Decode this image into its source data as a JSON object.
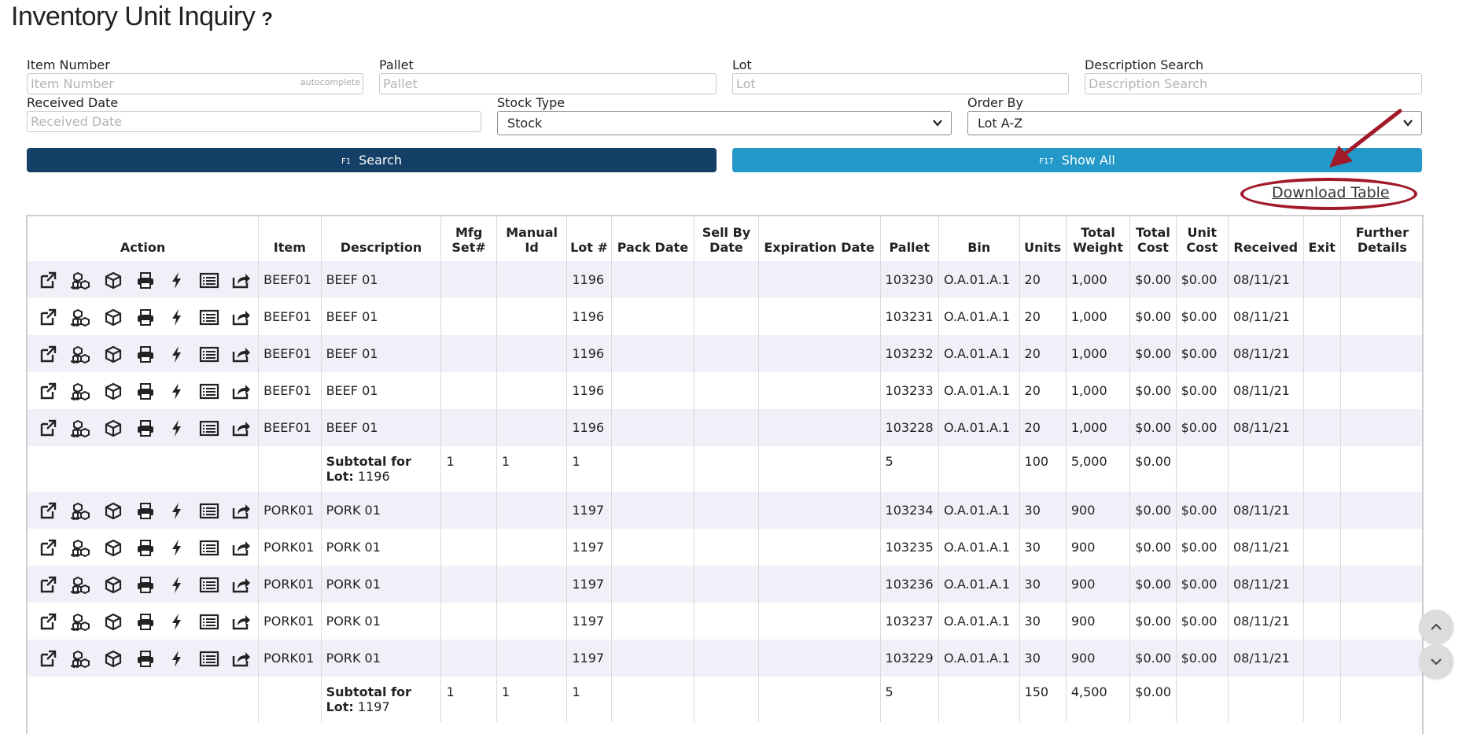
{
  "page": {
    "title": "Inventory Unit Inquiry",
    "help_label": "?"
  },
  "filters": {
    "item_number": {
      "label": "Item Number",
      "placeholder": "Item Number",
      "hint": "autocomplete"
    },
    "pallet": {
      "label": "Pallet",
      "placeholder": "Pallet"
    },
    "lot": {
      "label": "Lot",
      "placeholder": "Lot"
    },
    "description": {
      "label": "Description Search",
      "placeholder": "Description Search"
    },
    "received_date": {
      "label": "Received Date",
      "placeholder": "Received Date"
    },
    "stock_type": {
      "label": "Stock Type",
      "value": "Stock"
    },
    "order_by": {
      "label": "Order By",
      "value": "Lot A-Z"
    }
  },
  "buttons": {
    "search": {
      "key": "F1",
      "label": "Search"
    },
    "show_all": {
      "key": "F17",
      "label": "Show All"
    },
    "download": "Download Table"
  },
  "colors": {
    "search_button": "#143f66",
    "show_all_button": "#2399c9",
    "annotation": "#a11a2a",
    "row_stripe": "#eff0f8"
  },
  "action_icons": [
    "external-link-icon",
    "boxes-icon",
    "box-icon",
    "print-icon",
    "bolt-icon",
    "list-icon",
    "share-icon"
  ],
  "table": {
    "headers": [
      "Action",
      "Item",
      "Description",
      "Mfg Set#",
      "Manual Id",
      "Lot #",
      "Pack Date",
      "Sell By Date",
      "Expiration Date",
      "Pallet",
      "Bin",
      "Units",
      "Total Weight",
      "Total Cost",
      "Unit Cost",
      "Received",
      "Exit",
      "Further Details"
    ],
    "rows": [
      {
        "item": "BEEF01",
        "description": "BEEF 01",
        "lot": "1196",
        "pallet": "103230",
        "bin": "O.A.01.A.1",
        "units": "20",
        "weight": "1,000",
        "total_cost": "$0.00",
        "unit_cost": "$0.00",
        "received": "08/11/21"
      },
      {
        "item": "BEEF01",
        "description": "BEEF 01",
        "lot": "1196",
        "pallet": "103231",
        "bin": "O.A.01.A.1",
        "units": "20",
        "weight": "1,000",
        "total_cost": "$0.00",
        "unit_cost": "$0.00",
        "received": "08/11/21"
      },
      {
        "item": "BEEF01",
        "description": "BEEF 01",
        "lot": "1196",
        "pallet": "103232",
        "bin": "O.A.01.A.1",
        "units": "20",
        "weight": "1,000",
        "total_cost": "$0.00",
        "unit_cost": "$0.00",
        "received": "08/11/21"
      },
      {
        "item": "BEEF01",
        "description": "BEEF 01",
        "lot": "1196",
        "pallet": "103233",
        "bin": "O.A.01.A.1",
        "units": "20",
        "weight": "1,000",
        "total_cost": "$0.00",
        "unit_cost": "$0.00",
        "received": "08/11/21"
      },
      {
        "item": "BEEF01",
        "description": "BEEF 01",
        "lot": "1196",
        "pallet": "103228",
        "bin": "O.A.01.A.1",
        "units": "20",
        "weight": "1,000",
        "total_cost": "$0.00",
        "unit_cost": "$0.00",
        "received": "08/11/21"
      },
      {
        "item": "PORK01",
        "description": "PORK 01",
        "lot": "1197",
        "pallet": "103234",
        "bin": "O.A.01.A.1",
        "units": "30",
        "weight": "900",
        "total_cost": "$0.00",
        "unit_cost": "$0.00",
        "received": "08/11/21"
      },
      {
        "item": "PORK01",
        "description": "PORK 01",
        "lot": "1197",
        "pallet": "103235",
        "bin": "O.A.01.A.1",
        "units": "30",
        "weight": "900",
        "total_cost": "$0.00",
        "unit_cost": "$0.00",
        "received": "08/11/21"
      },
      {
        "item": "PORK01",
        "description": "PORK 01",
        "lot": "1197",
        "pallet": "103236",
        "bin": "O.A.01.A.1",
        "units": "30",
        "weight": "900",
        "total_cost": "$0.00",
        "unit_cost": "$0.00",
        "received": "08/11/21"
      },
      {
        "item": "PORK01",
        "description": "PORK 01",
        "lot": "1197",
        "pallet": "103237",
        "bin": "O.A.01.A.1",
        "units": "30",
        "weight": "900",
        "total_cost": "$0.00",
        "unit_cost": "$0.00",
        "received": "08/11/21"
      },
      {
        "item": "PORK01",
        "description": "PORK 01",
        "lot": "1197",
        "pallet": "103229",
        "bin": "O.A.01.A.1",
        "units": "30",
        "weight": "900",
        "total_cost": "$0.00",
        "unit_cost": "$0.00",
        "received": "08/11/21"
      }
    ],
    "subtotals": [
      {
        "label": "Subtotal for Lot:",
        "lot": "1196",
        "mfg": "1",
        "manual": "1",
        "lot_count": "1",
        "pallets": "5",
        "units": "100",
        "weight": "5,000",
        "total_cost": "$0.00"
      },
      {
        "label": "Subtotal for Lot:",
        "lot": "1197",
        "mfg": "1",
        "manual": "1",
        "lot_count": "1",
        "pallets": "5",
        "units": "150",
        "weight": "4,500",
        "total_cost": "$0.00"
      }
    ]
  },
  "scroll": {
    "up": "︿",
    "down": "﹀"
  }
}
